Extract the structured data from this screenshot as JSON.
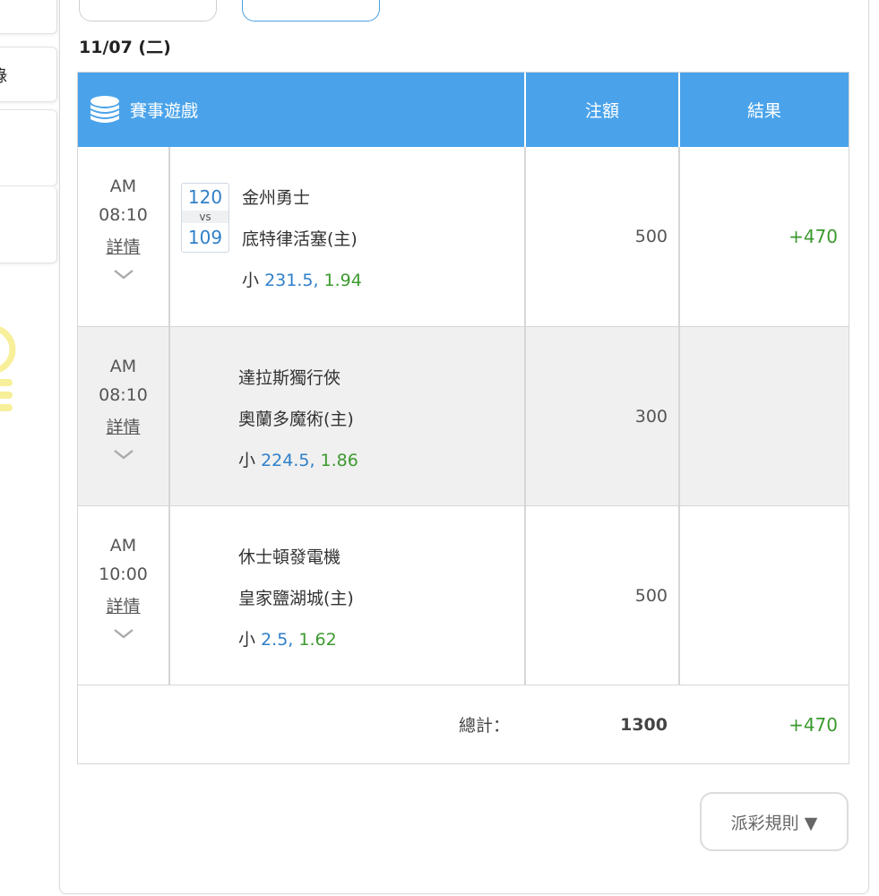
{
  "sidebar": {
    "partial_text": "錄"
  },
  "date": "11/07 (二)",
  "table": {
    "headers": {
      "game": "賽事遊戲",
      "bet": "注額",
      "result": "結果"
    },
    "rows": [
      {
        "ampm": "AM",
        "time": "08:10",
        "detail": "詳情",
        "score_home": "120",
        "vs": "vs",
        "score_away": "109",
        "team1": "金州勇士",
        "team2": "底特律活塞(主)",
        "pick": "小",
        "line": "231.5,",
        "price": "1.94",
        "bet": "500",
        "result": "+470"
      },
      {
        "ampm": "AM",
        "time": "08:10",
        "detail": "詳情",
        "team1": "達拉斯獨行俠",
        "team2": "奧蘭多魔術(主)",
        "pick": "小",
        "line": "224.5,",
        "price": "1.86",
        "bet": "300",
        "result": ""
      },
      {
        "ampm": "AM",
        "time": "10:00",
        "detail": "詳情",
        "team1": "休士頓發電機",
        "team2": "皇家鹽湖城(主)",
        "pick": "小",
        "line": "2.5,",
        "price": "1.62",
        "bet": "500",
        "result": ""
      }
    ],
    "total": {
      "label": "總計：",
      "bet": "1300",
      "result": "+470"
    }
  },
  "rules_button": "派彩規則 ▼",
  "colors": {
    "header_blue": "#4aa3ea",
    "win_green": "#3c9a2f",
    "link_blue": "#2f7fc8"
  }
}
